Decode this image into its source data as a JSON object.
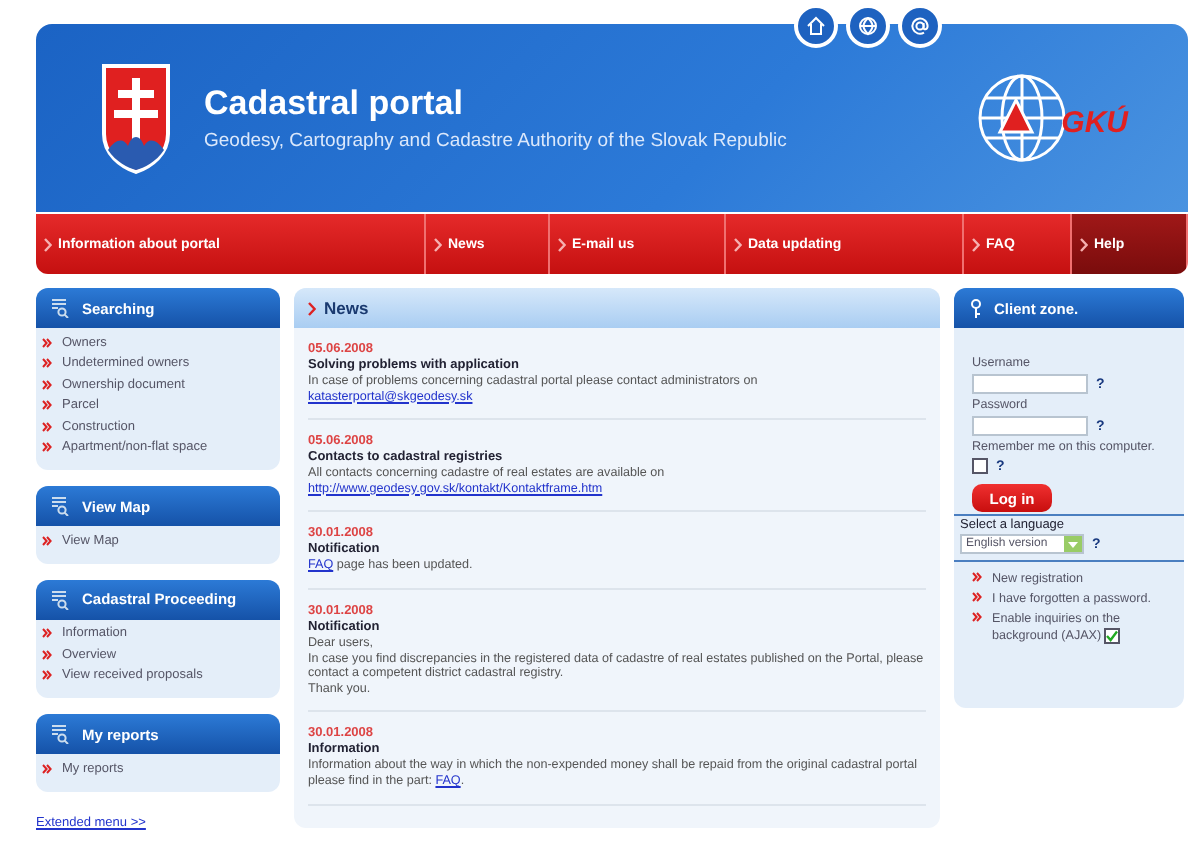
{
  "header": {
    "title": "Cadastral portal",
    "subtitle": "Geodesy, Cartography and Cadastre Authority of the Slovak Republic",
    "logo_text": "GKÚ"
  },
  "nav": [
    {
      "label": "Information about portal",
      "selected": false
    },
    {
      "label": "News",
      "selected": false
    },
    {
      "label": "E-mail us",
      "selected": false
    },
    {
      "label": "Data updating",
      "selected": false
    },
    {
      "label": "FAQ",
      "selected": false
    },
    {
      "label": "Help",
      "selected": true
    }
  ],
  "sidebar": {
    "panels": [
      {
        "title": "Searching",
        "items": [
          "Owners",
          "Undetermined owners",
          "Ownership document",
          "Parcel",
          "Construction",
          "Apartment/non-flat space"
        ]
      },
      {
        "title": "View Map",
        "items": [
          "View Map"
        ]
      },
      {
        "title": "Cadastral Proceeding",
        "items": [
          "Information",
          "Overview",
          "View received proposals"
        ]
      },
      {
        "title": "My reports",
        "items": [
          "My reports"
        ]
      }
    ],
    "extended_link": "Extended menu >>"
  },
  "news": {
    "title": "News",
    "entries": [
      {
        "date": "05.06.2008",
        "title": "Solving problems with application",
        "lines": [
          [
            {
              "kind": "text",
              "text": "In case of problems concerning cadastral portal please contact administrators on"
            }
          ],
          [
            {
              "kind": "link",
              "text": "katasterportal@skgeodesy.sk"
            }
          ]
        ]
      },
      {
        "date": "05.06.2008",
        "title": "Contacts to cadastral registries",
        "lines": [
          [
            {
              "kind": "text",
              "text": "All contacts concerning cadastre of real estates are available on"
            }
          ],
          [
            {
              "kind": "link",
              "text": "http://www.geodesy.gov.sk/kontakt/Kontaktframe.htm"
            }
          ]
        ]
      },
      {
        "date": "30.01.2008",
        "title": "Notification",
        "lines": [
          [
            {
              "kind": "link",
              "text": "FAQ"
            },
            {
              "kind": "text",
              "text": " page has been updated."
            }
          ]
        ]
      },
      {
        "date": "30.01.2008",
        "title": "Notification",
        "lines": [
          [
            {
              "kind": "text",
              "text": "Dear users,"
            }
          ],
          [
            {
              "kind": "text",
              "text": "In case you find discrepancies in the registered data of cadastre of real estates published on the Portal, please contact a competent district cadastral registry."
            }
          ],
          [
            {
              "kind": "text",
              "text": "Thank you."
            }
          ]
        ]
      },
      {
        "date": "30.01.2008",
        "title": "Information",
        "lines": [
          [
            {
              "kind": "text",
              "text": "Information about the way in which the non-expended money shall be repaid from the original cadastral portal please find in the part: "
            },
            {
              "kind": "link",
              "text": "FAQ"
            },
            {
              "kind": "text",
              "text": "."
            }
          ]
        ]
      }
    ]
  },
  "client_zone": {
    "title": "Client zone.",
    "username_label": "Username",
    "password_label": "Password",
    "help_mark": "?",
    "remember_label": "Remember me on this computer.",
    "remember_checked": false,
    "login_button": "Log in",
    "language_label": "Select a language",
    "language_value": "English version",
    "links": [
      {
        "label": "New registration"
      },
      {
        "label": "I have forgotten a password."
      },
      {
        "label": "Enable inquiries on the background (AJAX)",
        "checked": true
      }
    ]
  }
}
